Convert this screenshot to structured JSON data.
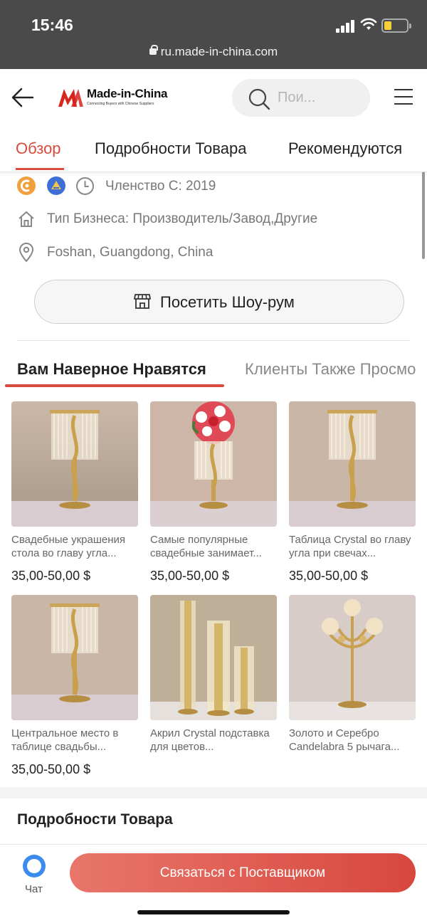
{
  "status_bar": {
    "time": "15:46",
    "url": "ru.made-in-china.com"
  },
  "header": {
    "logo_text": "Made-in-China",
    "logo_tagline": "Connecting Buyers with Chinese Suppliers",
    "search_placeholder": "Пои..."
  },
  "tabs": [
    {
      "label": "Обзор",
      "active": true
    },
    {
      "label": "Подробности Товара",
      "active": false
    },
    {
      "label": "Рекомендуются",
      "active": false
    }
  ],
  "supplier": {
    "membership": "Членство С: 2019",
    "business_type": "Тип Бизнеса: Производитель/Завод,Другие",
    "location": "Foshan, Guangdong, China",
    "visit_button": "Посетить Шоу-рум"
  },
  "rec_tabs": [
    {
      "label": "Вам Наверное Нравятся",
      "active": true
    },
    {
      "label": "Клиенты Также Просмо",
      "active": false
    }
  ],
  "products": [
    {
      "title": "Свадебные украшения стола во главу угла...",
      "price": "35,00-50,00 $"
    },
    {
      "title": "Самые популярные свадебные занимает...",
      "price": "35,00-50,00 $"
    },
    {
      "title": "Таблица Crystal во главу угла при свечах...",
      "price": "35,00-50,00 $"
    },
    {
      "title": "Центральное место в таблице свадьбы...",
      "price": "35,00-50,00 $"
    },
    {
      "title": "Акрил Crystal подставка для цветов...",
      "price": ""
    },
    {
      "title": "Золото и Серебро Candelabra 5 рычага...",
      "price": ""
    }
  ],
  "details_title": "Подробности Товара",
  "bottom_bar": {
    "chat_label": "Чат",
    "contact_button": "Связаться с Поставщиком"
  },
  "colors": {
    "accent": "#d84b3f",
    "button_gradient_start": "#e8766a",
    "button_gradient_end": "#d8473e",
    "chat_blue": "#3c8cf0"
  }
}
